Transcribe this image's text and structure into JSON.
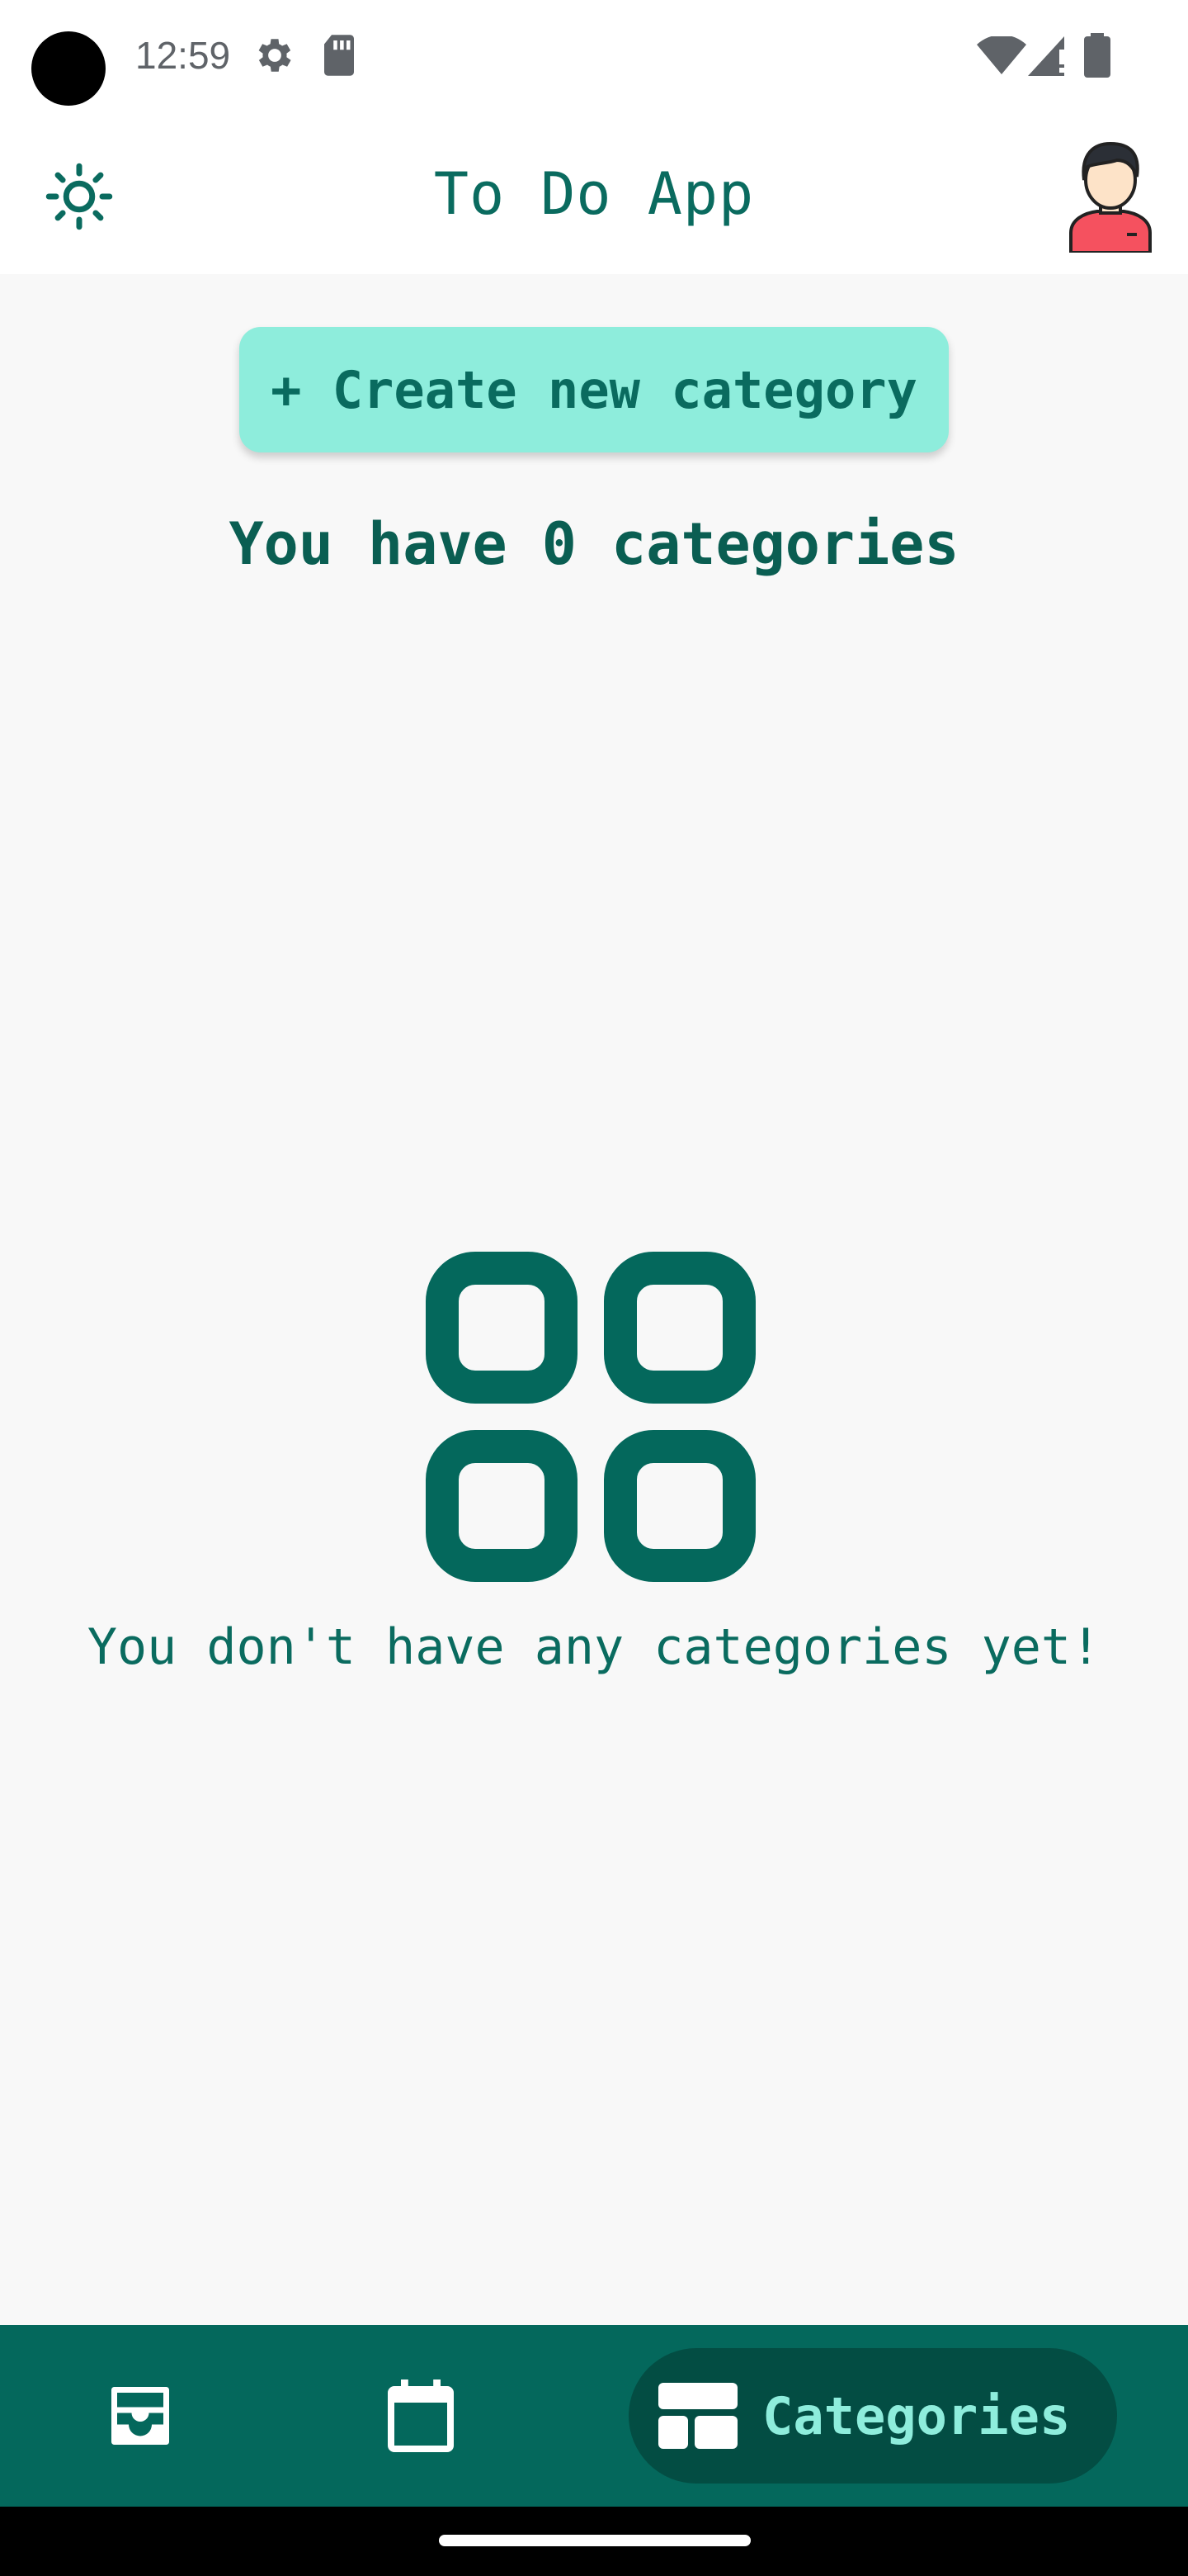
{
  "status_bar": {
    "time": "12:59",
    "icons": [
      "settings-icon",
      "sd-card-icon",
      "wifi-icon",
      "signal-icon",
      "battery-icon"
    ]
  },
  "app_bar": {
    "title": "To Do App",
    "theme_icon": "sun-icon",
    "avatar": "avatar"
  },
  "main": {
    "create_button_label": "+ Create new category",
    "count_text": "You have 0 categories",
    "empty_icon": "grid-icon",
    "empty_text": "You don't have any categories yet!"
  },
  "bottom_nav": {
    "items": [
      {
        "icon": "inbox-icon",
        "label": ""
      },
      {
        "icon": "calendar-icon",
        "label": ""
      },
      {
        "icon": "categories-icon",
        "label": "Categories",
        "active": true
      }
    ]
  },
  "colors": {
    "primary": "#0a6b5f",
    "accent": "#8eeddc",
    "nav_background": "#04685c",
    "nav_active_pill": "#034d43",
    "background": "#f8f8f8"
  }
}
